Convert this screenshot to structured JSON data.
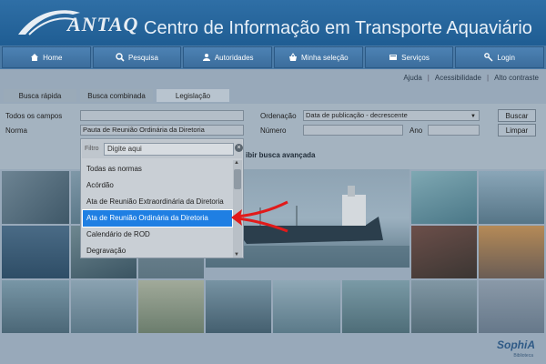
{
  "header": {
    "logo_text": "ANTAQ",
    "title": "Centro de Informação em Transporte Aquaviário"
  },
  "nav": [
    {
      "label": "Home",
      "icon": "home-icon"
    },
    {
      "label": "Pesquisa",
      "icon": "search-icon"
    },
    {
      "label": "Autoridades",
      "icon": "users-icon"
    },
    {
      "label": "Minha seleção",
      "icon": "basket-icon"
    },
    {
      "label": "Serviços",
      "icon": "services-icon"
    },
    {
      "label": "Login",
      "icon": "key-icon"
    }
  ],
  "util_links": [
    "Ajuda",
    "Acessibilidade",
    "Alto contraste"
  ],
  "tabs": [
    "Busca rápida",
    "Busca combinada",
    "Legislação"
  ],
  "form": {
    "todos_label": "Todos os campos",
    "todos_value": "",
    "norma_label": "Norma",
    "norma_value": "Pauta de Reunião Ordinária da Diretoria",
    "ordenacao_label": "Ordenação",
    "ordenacao_value": "Data de publicação - decrescente",
    "numero_label": "Número",
    "numero_value": "",
    "ano_label": "Ano",
    "ano_value": "",
    "buscar_label": "Buscar",
    "limpar_label": "Limpar",
    "advanced_label": "Exibir busca avançada",
    "advanced_visible": "ibir busca avançada"
  },
  "dropdown": {
    "filter_label": "Filtro",
    "filter_placeholder": "Digite aqui",
    "options": [
      "Todas as normas",
      "Acórdão",
      "Ata de Reunião Extraordinária da Diretoria",
      "Ata de Reunião Ordinária da Diretoria",
      "Calendário de ROD",
      "Degravação"
    ],
    "selected_index": 3
  },
  "footer": {
    "brand": "SophiA",
    "brand_sub": "Biblioteca"
  },
  "colors": {
    "header_bg": "#1f5d93",
    "nav_bg": "#4a7aa6",
    "highlight": "#1f7fe3",
    "arrow": "#e11a1a"
  }
}
